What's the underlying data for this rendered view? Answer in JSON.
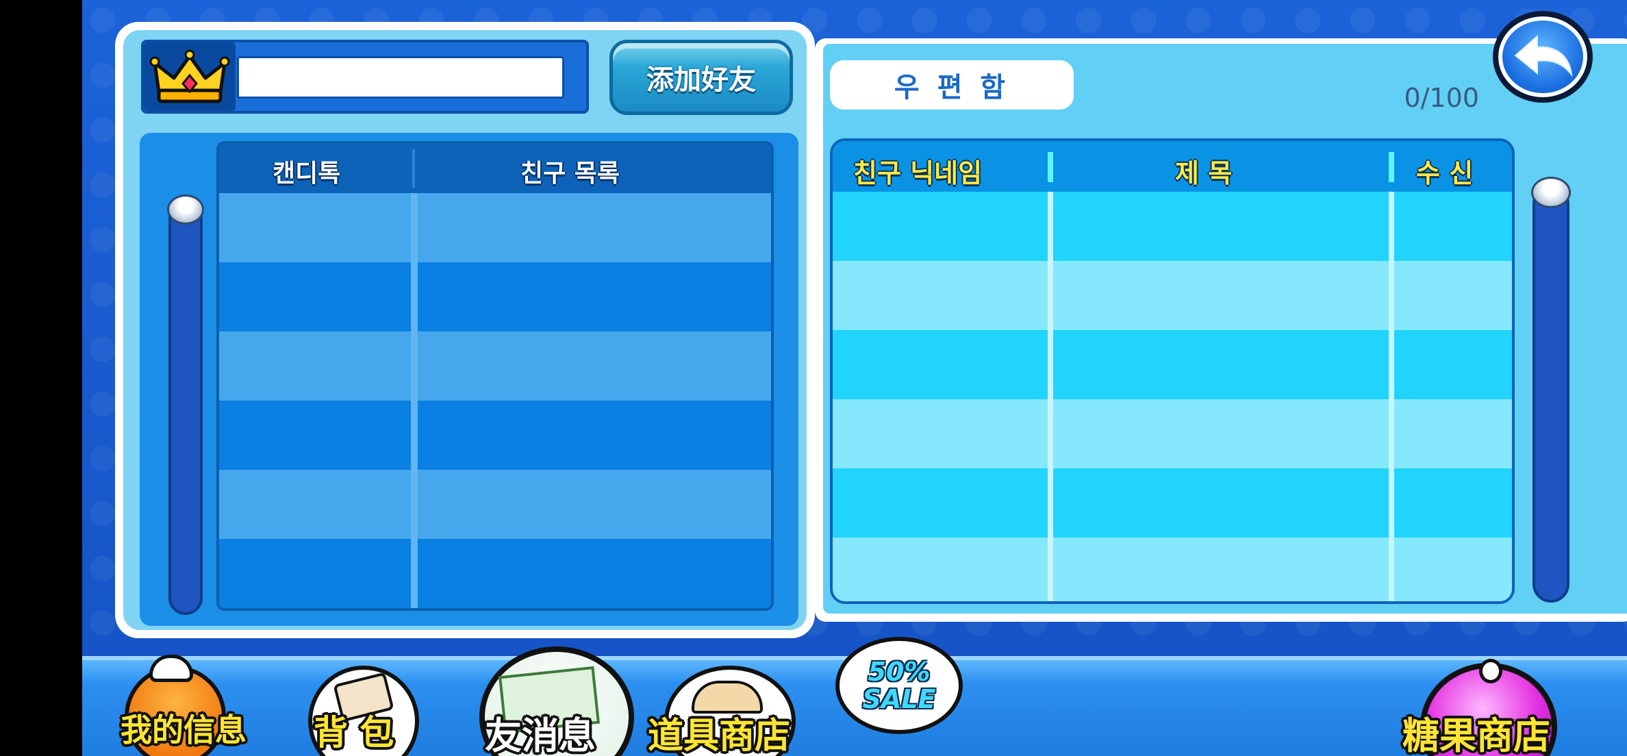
{
  "friend_panel": {
    "add_friend_label": "添加好友",
    "name_input_value": "",
    "columns": [
      "캔디톡",
      "친구 목록"
    ]
  },
  "mailbox": {
    "tab_label": "우 편 함",
    "count": "0/100",
    "columns": [
      "친구 닉네임",
      "제  목",
      "수 신"
    ]
  },
  "bottom_menu": {
    "my_info": "我的信息",
    "backpack": "背  包",
    "friend_messages": "友消息",
    "item_shop": "道具商店",
    "sale_top": "50%",
    "sale_bottom": "SALE",
    "candy_shop": "糖果商店"
  },
  "colors": {
    "background": "#1552c4",
    "panel_white": "#ffffff",
    "header_text_yellow": "#ffe94a",
    "add_button": "#1b8bc3"
  }
}
